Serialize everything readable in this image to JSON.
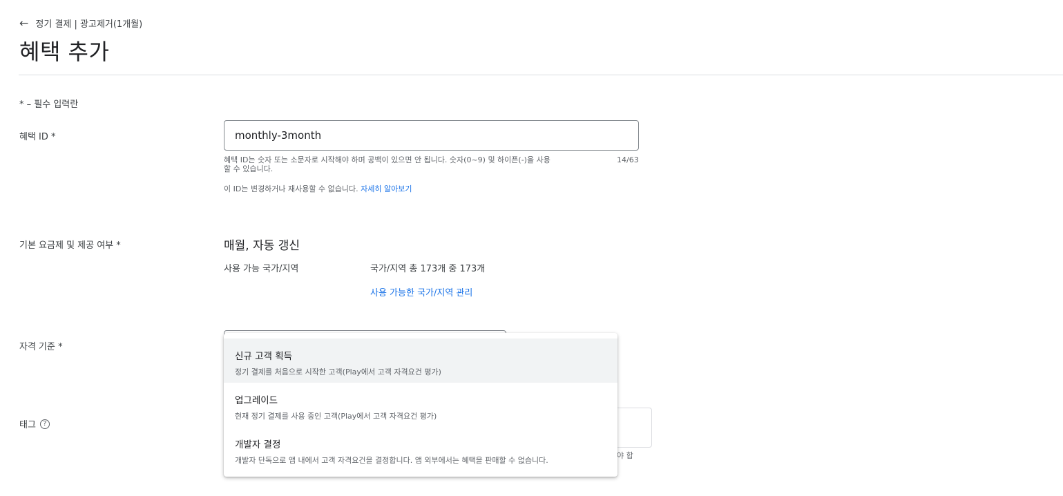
{
  "header": {
    "breadcrumb": "정기 결제 | 광고제거(1개월)",
    "title": "혜택 추가"
  },
  "form": {
    "required_note": "* – 필수 입력란",
    "offer_id": {
      "label": "혜택 ID  *",
      "value": "monthly-3month",
      "helper_line1": "혜택 ID는 숫자 또는 소문자로 시작해야 하며 공백이 있으면 안 됩니다. 숫자(0~9) 및 하이픈(-)을 사용",
      "helper_line2": "할 수 있습니다.",
      "counter": "14/63",
      "note": "이 ID는 변경하거나 재사용할 수 없습니다. ",
      "learn_more": "자세히 알아보기"
    },
    "base_plan": {
      "label": "기본 요금제 및 제공 여부  *",
      "name": "매월, 자동 갱신",
      "availability_label": "사용 가능 국가/지역",
      "availability_value": "국가/지역 총 173개 중 173개",
      "manage_link": "사용 가능한 국가/지역 관리"
    },
    "eligibility": {
      "label": "자격 기준  *",
      "options": [
        {
          "title": "신규 고객 획득",
          "desc": "정기 결제를 처음으로 시작한 고객(Play에서 고객 자격요건 평가)"
        },
        {
          "title": "업그레이드",
          "desc": "현재 정기 결제를 사용 중인 고객(Play에서 고객 자격요건 평가)"
        },
        {
          "title": "개발자 결정",
          "desc": "개발자 단독으로 앱 내에서 고객 자격요건을 결정합니다. 앱 외부에서는 혜택을 판매할 수 없습니다."
        }
      ]
    },
    "tags": {
      "label": "태그",
      "help_icon": "help-circle-icon",
      "clipped_helper": "야 합"
    }
  },
  "icons": {
    "back": "arrow-back-icon"
  },
  "colors": {
    "link": "#1a73e8",
    "menu_highlight": "#f1f3f4"
  }
}
